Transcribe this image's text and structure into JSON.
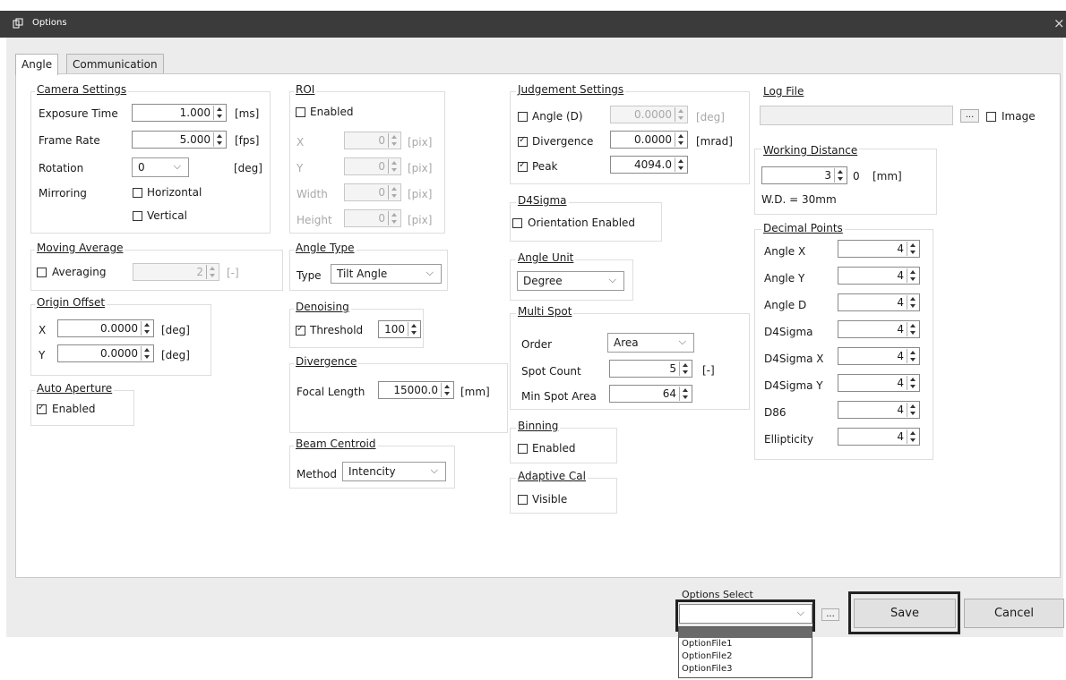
{
  "window": {
    "title": "Options",
    "icon": "window-icon",
    "close_glyph": "×"
  },
  "tabs": [
    "Angle",
    "Communication"
  ],
  "camera": {
    "title": "Camera Settings",
    "exposure_label": "Exposure Time",
    "exposure_value": "1.000",
    "exposure_unit": "[ms]",
    "frame_label": "Frame Rate",
    "frame_value": "5.000",
    "frame_unit": "[fps]",
    "rotation_label": "Rotation",
    "rotation_value": "0",
    "rotation_unit": "[deg]",
    "mirroring_label": "Mirroring",
    "horizontal": "Horizontal",
    "vertical": "Vertical"
  },
  "moving_average": {
    "title": "Moving Average",
    "averaging": "Averaging",
    "value": "2",
    "unit": "[-]"
  },
  "origin_offset": {
    "title": "Origin Offset",
    "x_label": "X",
    "x_value": "0.0000",
    "y_label": "Y",
    "y_value": "0.0000",
    "unit": "[deg]"
  },
  "auto_aperture": {
    "title": "Auto Aperture",
    "enabled": "Enabled"
  },
  "roi": {
    "title": "ROI",
    "enabled": "Enabled",
    "x_label": "X",
    "y_label": "Y",
    "width_label": "Width",
    "height_label": "Height",
    "value": "0",
    "unit": "[pix]"
  },
  "angle_type": {
    "title": "Angle Type",
    "type_label": "Type",
    "type_value": "Tilt Angle"
  },
  "denoising": {
    "title": "Denoising",
    "threshold": "Threshold",
    "threshold_value": "100"
  },
  "divergence": {
    "title": "Divergence",
    "focal_label": "Focal Length",
    "focal_value": "15000.0",
    "unit": "[mm]"
  },
  "beam_centroid": {
    "title": "Beam Centroid",
    "method_label": "Method",
    "method_value": "Intencity"
  },
  "judgement": {
    "title": "Judgement Settings",
    "angle_label": "Angle (D)",
    "angle_value": "0.0000",
    "angle_unit": "[deg]",
    "divergence_label": "Divergence",
    "divergence_value": "0.0000",
    "divergence_unit": "[mrad]",
    "peak_label": "Peak",
    "peak_value": "4094.0"
  },
  "d4sigma": {
    "title": "D4Sigma",
    "orientation": "Orientation Enabled"
  },
  "angle_unit": {
    "title": "Angle Unit",
    "value": "Degree"
  },
  "multi_spot": {
    "title": "Multi Spot",
    "order_label": "Order",
    "order_value": "Area",
    "count_label": "Spot Count",
    "count_value": "5",
    "count_unit": "[-]",
    "min_label": "Min Spot Area",
    "min_value": "64"
  },
  "binning": {
    "title": "Binning",
    "enabled": "Enabled"
  },
  "adaptive_cal": {
    "title": "Adaptive Cal",
    "visible": "Visible"
  },
  "log_file": {
    "title": "Log File",
    "browse": "...",
    "image": "Image"
  },
  "working_distance": {
    "title": "Working Distance",
    "value": "3",
    "extra": "0",
    "unit": "[mm]",
    "note": "W.D. = 30mm"
  },
  "decimal_points": {
    "title": "Decimal Points",
    "items": [
      {
        "label": "Angle X",
        "value": "4"
      },
      {
        "label": "Angle Y",
        "value": "4"
      },
      {
        "label": "Angle D",
        "value": "4"
      },
      {
        "label": "D4Sigma",
        "value": "4"
      },
      {
        "label": "D4Sigma X",
        "value": "4"
      },
      {
        "label": "D4Sigma Y",
        "value": "4"
      },
      {
        "label": "D86",
        "value": "4"
      },
      {
        "label": "Ellipticity",
        "value": "4"
      }
    ]
  },
  "footer": {
    "options_select_label": "Options Select",
    "browse": "...",
    "save": "Save",
    "cancel": "Cancel",
    "dropdown_options": [
      "OptionFile1",
      "OptionFile2",
      "OptionFile3"
    ]
  },
  "checks": {
    "horizontal": false,
    "vertical": false,
    "averaging": false,
    "auto_aperture": true,
    "roi": false,
    "threshold": true,
    "judge_angle": false,
    "judge_divergence": true,
    "judge_peak": true,
    "orientation": false,
    "binning": false,
    "adaptive": false,
    "log_image": false
  }
}
